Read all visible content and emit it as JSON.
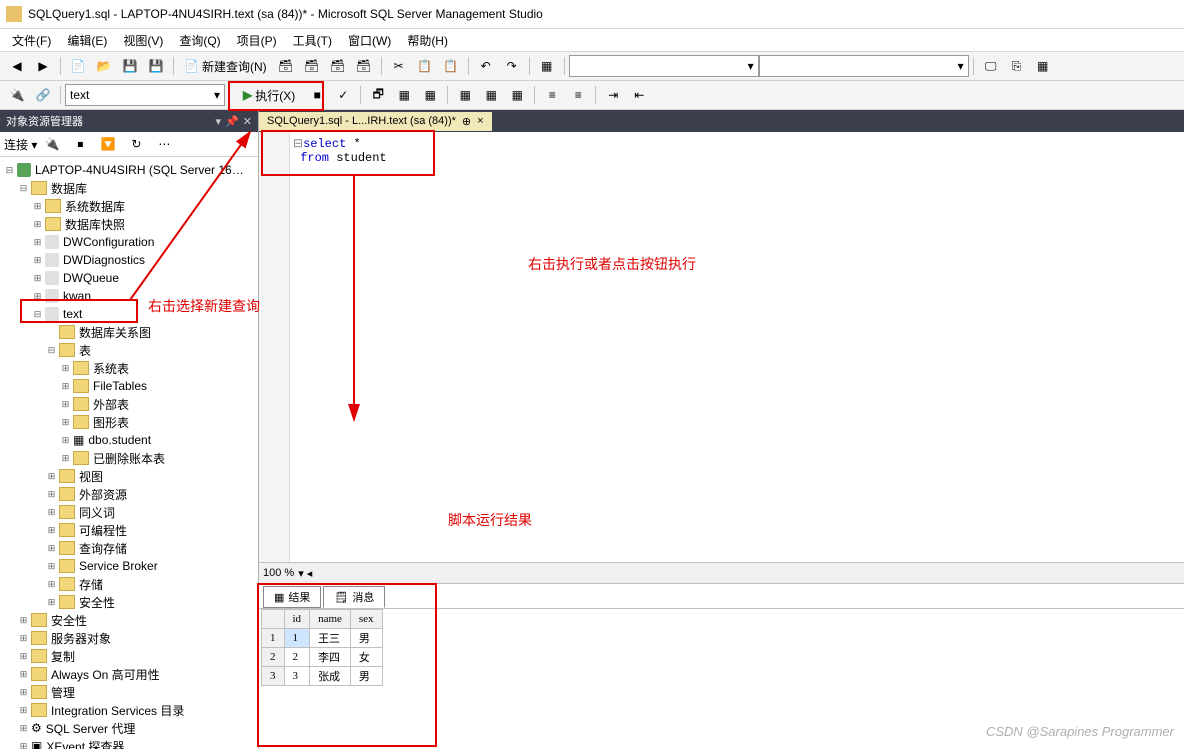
{
  "window": {
    "title": "SQLQuery1.sql - LAPTOP-4NU4SIRH.text (sa (84))* - Microsoft SQL Server Management Studio"
  },
  "menu": {
    "file": "文件(F)",
    "edit": "编辑(E)",
    "view": "视图(V)",
    "query": "查询(Q)",
    "project": "项目(P)",
    "tools": "工具(T)",
    "window": "窗口(W)",
    "help": "帮助(H)"
  },
  "toolbar": {
    "newquery": "新建查询(N)",
    "exec": "执行(X)",
    "dbcombo": "text"
  },
  "panel": {
    "title": "对象资源管理器",
    "connect": "连接",
    "server": "LAPTOP-4NU4SIRH (SQL Server 16…",
    "nodes": {
      "databases": "数据库",
      "sysdb": "系统数据库",
      "snapshot": "数据库快照",
      "dwc": "DWConfiguration",
      "dwd": "DWDiagnostics",
      "dwq": "DWQueue",
      "kwan": "kwan",
      "text": "text",
      "dbdiagram": "数据库关系图",
      "tables": "表",
      "systables": "系统表",
      "filetables": "FileTables",
      "external": "外部表",
      "graph": "图形表",
      "student": "dbo.student",
      "deleted": "已删除账本表",
      "views": "视图",
      "extres": "外部资源",
      "synonym": "同义词",
      "programmability": "可编程性",
      "querystore": "查询存储",
      "servicebroker": "Service Broker",
      "storage": "存储",
      "security": "安全性",
      "security2": "安全性",
      "serverobj": "服务器对象",
      "replication": "复制",
      "alwayson": "Always On 高可用性",
      "management": "管理",
      "integration": "Integration Services 目录",
      "agent": "SQL Server 代理",
      "xevent": "XEvent 探查器"
    }
  },
  "tab": {
    "label": "SQLQuery1.sql - L...IRH.text (sa (84))*",
    "pin": "⊕",
    "close": "×"
  },
  "code": {
    "select": "select",
    "star": " *",
    "from": "from",
    "table": " student"
  },
  "zoom": "100 %",
  "results": {
    "tab1": "结果",
    "tab2": "消息",
    "cols": [
      "id",
      "name",
      "sex"
    ],
    "rows": [
      {
        "n": "1",
        "id": "1",
        "name": "王三",
        "sex": "男"
      },
      {
        "n": "2",
        "id": "2",
        "name": "李四",
        "sex": "女"
      },
      {
        "n": "3",
        "id": "3",
        "name": "张成",
        "sex": "男"
      }
    ]
  },
  "anno": {
    "a1": "右击选择新建查询",
    "a2": "右击执行或者点击按钮执行",
    "a3": "脚本运行结果"
  },
  "watermark": "CSDN @Sarapines Programmer"
}
